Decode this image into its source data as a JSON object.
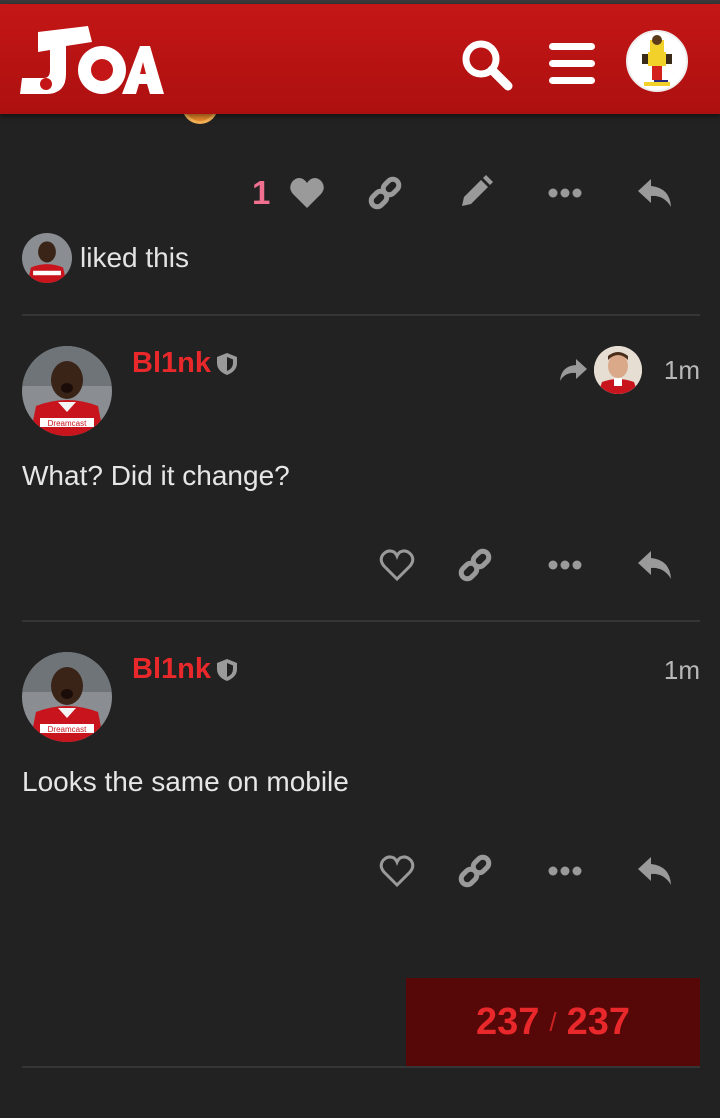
{
  "header": {
    "logo_text": "JOA",
    "search_icon": "search-icon",
    "menu_icon": "hamburger-menu-icon",
    "user_avatar": "user-avatar"
  },
  "colors": {
    "header_red": "#c41616",
    "background": "#222222",
    "username_red": "#e8282a",
    "like_pink": "#f16f8f",
    "progress_bg": "#560707"
  },
  "previous_post": {
    "like_count": "1",
    "liked_by_text": "liked this",
    "actions": [
      "heart-icon",
      "link-icon",
      "pencil-icon",
      "more-icon",
      "reply-icon"
    ]
  },
  "posts": [
    {
      "username": "Bl1nk",
      "moderator_icon": "shield-icon",
      "reply_to_icon": "share-arrow-icon",
      "time": "1m",
      "body": "What? Did it change?",
      "actions": [
        "heart-icon",
        "link-icon",
        "more-icon",
        "reply-icon"
      ]
    },
    {
      "username": "Bl1nk",
      "moderator_icon": "shield-icon",
      "time": "1m",
      "body": "Looks the same on mobile",
      "actions": [
        "heart-icon",
        "link-icon",
        "more-icon",
        "reply-icon"
      ]
    }
  ],
  "progress": {
    "current": "237",
    "separator": "/",
    "total": "237"
  }
}
